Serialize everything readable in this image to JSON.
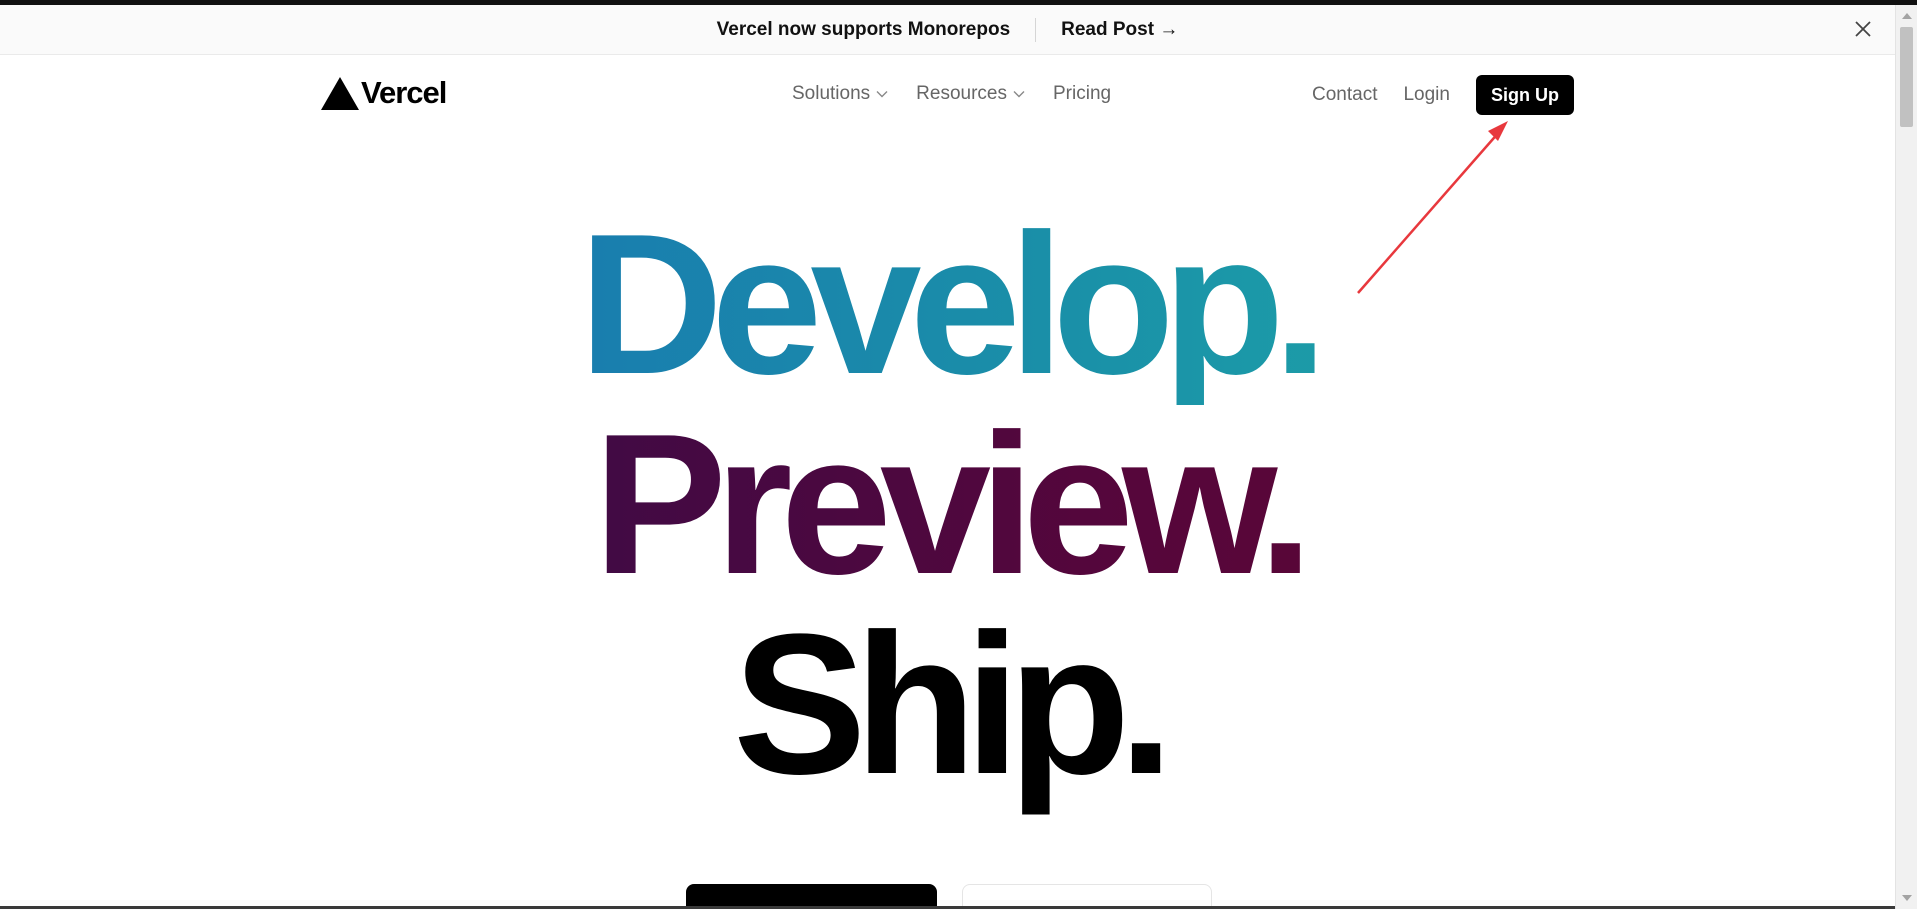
{
  "banner": {
    "text": "Vercel now supports Monorepos",
    "link_label": "Read Post →",
    "close_icon": "close-icon"
  },
  "nav": {
    "logo_text": "Vercel",
    "logo_icon": "triangle-logo-icon",
    "menu": [
      {
        "label": "Solutions",
        "icon": "chevron-down-icon"
      },
      {
        "label": "Resources",
        "icon": "chevron-down-icon"
      },
      {
        "label": "Pricing"
      }
    ],
    "contact_label": "Contact",
    "login_label": "Login",
    "signup_label": "Sign Up"
  },
  "hero": {
    "line1": "Develop.",
    "line2": "Preview.",
    "line3": "Ship."
  },
  "colors": {
    "annotation_arrow": "#e8383d",
    "develop_start": "#1868b7",
    "develop_end": "#1fb3a6",
    "preview_start": "#2b0e4e",
    "preview_end": "#62062e"
  }
}
